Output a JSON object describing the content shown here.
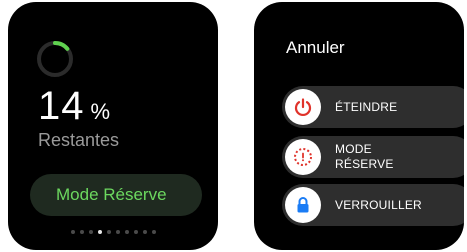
{
  "battery_screen": {
    "percent_value": "14",
    "percent_unit": "%",
    "percent_fraction": 0.14,
    "remaining_label": "Restantes",
    "mode_button_label": "Mode Réserve",
    "ring_color": "#5fd14f",
    "page_dots": {
      "count": 10,
      "active_index": 3
    }
  },
  "power_menu": {
    "cancel_label": "Annuler",
    "sliders": [
      {
        "icon": "power-icon",
        "icon_color": "#e0332b",
        "label_line1": "ÉTEINDRE",
        "label_line2": ""
      },
      {
        "icon": "reserve-icon",
        "icon_color": "#e0332b",
        "label_line1": "MODE",
        "label_line2": "RÉSERVE"
      },
      {
        "icon": "lock-icon",
        "icon_color": "#1a7cf5",
        "label_line1": "VERROUILLER",
        "label_line2": ""
      }
    ]
  }
}
